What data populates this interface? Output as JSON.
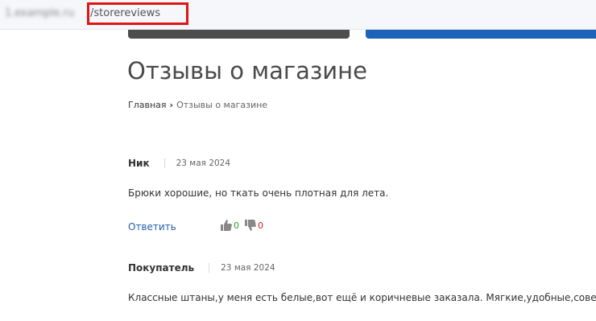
{
  "browser": {
    "url_host": "1.example.ru",
    "url_path": "/storereviews",
    "highlight_color": "#e01414"
  },
  "header": {
    "dark_button_color": "#4d4d4d",
    "blue_button_color": "#1c62b8"
  },
  "page": {
    "title": "Отзывы о магазине",
    "breadcrumb": {
      "home": "Главная",
      "current": "Отзывы о магазине"
    }
  },
  "reviews": [
    {
      "author": "Ник",
      "date": "23 мая 2024",
      "text": "Брюки хорошие, но ткать очень плотная для лета.",
      "reply_label": "Ответить",
      "likes": "0",
      "dislikes": "0"
    },
    {
      "author": "Покупатель",
      "date": "23 мая 2024",
      "text": "Классные штаны,у меня есть белые,вот ещё и коричневые заказала. Мягкие,удобные,советую п"
    }
  ],
  "icons": {
    "like": "thumbs-up-icon",
    "dislike": "thumbs-down-icon",
    "breadcrumb_separator": "chevron-right-icon"
  }
}
